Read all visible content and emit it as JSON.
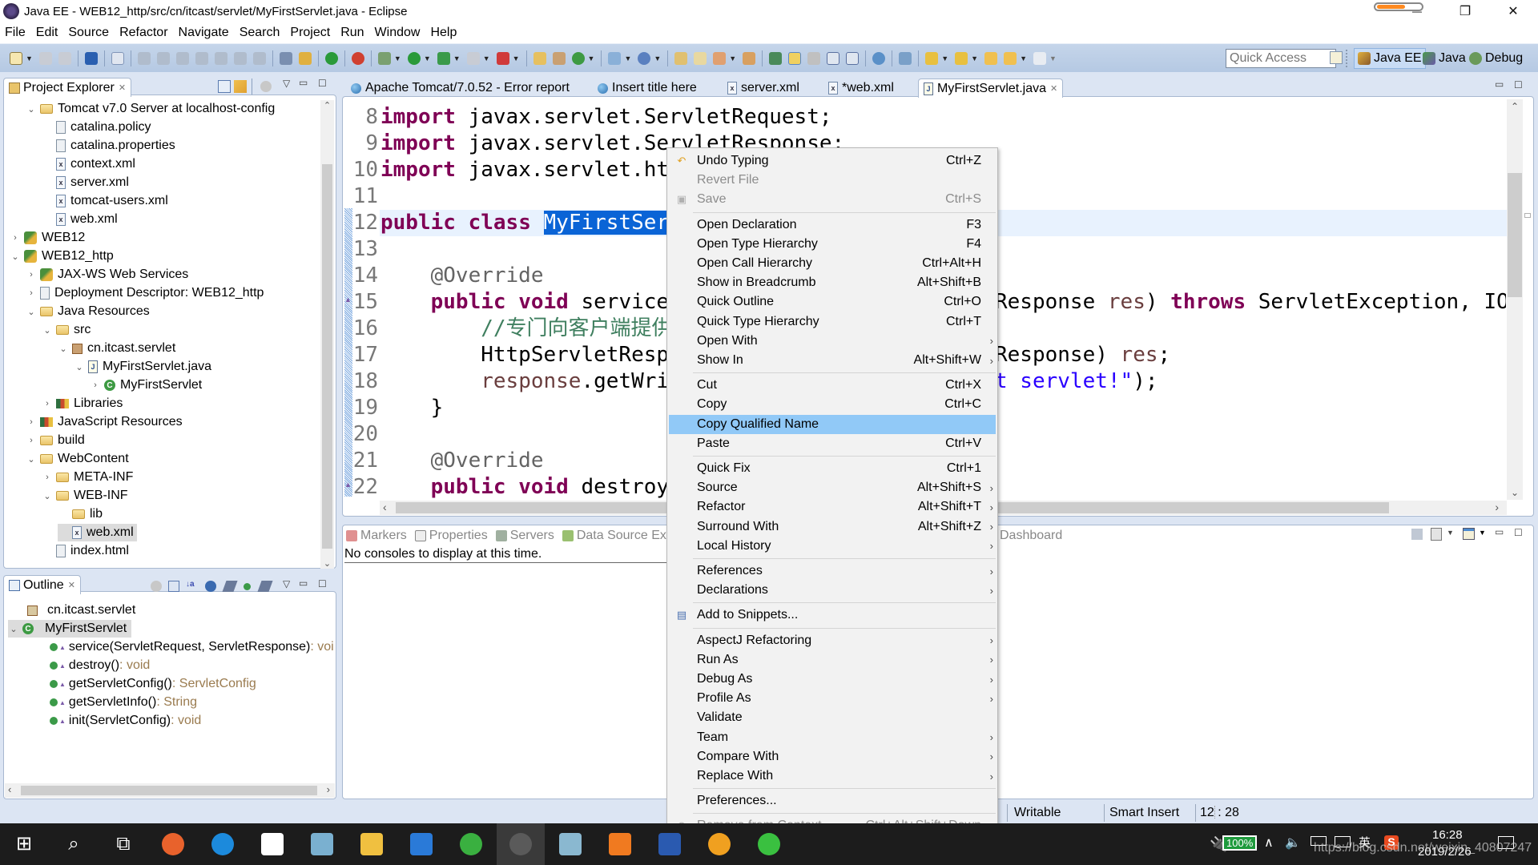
{
  "window": {
    "title": "Java EE - WEB12_http/src/cn/itcast/servlet/MyFirstServlet.java - Eclipse",
    "controls": {
      "minimize": "—",
      "restore": "❐",
      "close": "✕"
    },
    "background_progress_fraction": 0.65
  },
  "menubar": [
    "File",
    "Edit",
    "Source",
    "Refactor",
    "Navigate",
    "Search",
    "Project",
    "Run",
    "Window",
    "Help"
  ],
  "toolbar": {
    "quick_access_placeholder": "Quick Access",
    "perspectives": [
      {
        "label": "Java EE",
        "active": true
      },
      {
        "label": "Java",
        "active": false
      },
      {
        "label": "Debug",
        "active": false
      }
    ]
  },
  "project_explorer": {
    "title": "Project Explorer",
    "close": "✕",
    "items": [
      {
        "label": "Tomcat v7.0 Server at localhost-config",
        "twisty": "⌄",
        "icon": "folder-icon",
        "depth": 1
      },
      {
        "label": "catalina.policy",
        "twisty": "",
        "icon": "text-file-icon",
        "depth": 2
      },
      {
        "label": "catalina.properties",
        "twisty": "",
        "icon": "text-file-icon",
        "depth": 2
      },
      {
        "label": "context.xml",
        "twisty": "",
        "icon": "xml-file-icon",
        "depth": 2
      },
      {
        "label": "server.xml",
        "twisty": "",
        "icon": "xml-file-icon",
        "depth": 2
      },
      {
        "label": "tomcat-users.xml",
        "twisty": "",
        "icon": "xml-file-icon",
        "depth": 2
      },
      {
        "label": "web.xml",
        "twisty": "",
        "icon": "xml-file-icon",
        "depth": 2
      },
      {
        "label": "WEB12",
        "twisty": "›",
        "icon": "web-project-icon",
        "depth": 0
      },
      {
        "label": "WEB12_http",
        "twisty": "⌄",
        "icon": "web-project-icon",
        "depth": 0
      },
      {
        "label": "JAX-WS Web Services",
        "twisty": "›",
        "icon": "web-services-icon",
        "depth": 1
      },
      {
        "label": "Deployment Descriptor: WEB12_http",
        "twisty": "›",
        "icon": "deployment-descriptor-icon",
        "depth": 1
      },
      {
        "label": "Java Resources",
        "twisty": "⌄",
        "icon": "java-resources-icon",
        "depth": 1
      },
      {
        "label": "src",
        "twisty": "⌄",
        "icon": "source-folder-icon",
        "depth": 2
      },
      {
        "label": "cn.itcast.servlet",
        "twisty": "⌄",
        "icon": "package-icon",
        "depth": 3
      },
      {
        "label": "MyFirstServlet.java",
        "twisty": "⌄",
        "icon": "java-file-icon",
        "depth": 4
      },
      {
        "label": "MyFirstServlet",
        "twisty": "›",
        "icon": "class-icon",
        "depth": 5
      },
      {
        "label": "Libraries",
        "twisty": "›",
        "icon": "library-icon",
        "depth": 2
      },
      {
        "label": "JavaScript Resources",
        "twisty": "›",
        "icon": "library-icon",
        "depth": 1
      },
      {
        "label": "build",
        "twisty": "›",
        "icon": "folder-icon",
        "depth": 1
      },
      {
        "label": "WebContent",
        "twisty": "⌄",
        "icon": "folder-icon",
        "depth": 1
      },
      {
        "label": "META-INF",
        "twisty": "›",
        "icon": "folder-icon",
        "depth": 2
      },
      {
        "label": "WEB-INF",
        "twisty": "⌄",
        "icon": "folder-icon",
        "depth": 2
      },
      {
        "label": "lib",
        "twisty": "",
        "icon": "folder-icon",
        "depth": 3
      },
      {
        "label": "web.xml",
        "twisty": "",
        "icon": "xml-file-icon",
        "depth": 3,
        "selected": true
      },
      {
        "label": "index.html",
        "twisty": "",
        "icon": "html-file-icon",
        "depth": 2
      }
    ]
  },
  "outline": {
    "title": "Outline",
    "close": "✕",
    "package": "cn.itcast.servlet",
    "class_name": "MyFirstServlet",
    "members": [
      {
        "name": "service(ServletRequest, ServletResponse)",
        "type": " : voi"
      },
      {
        "name": "destroy()",
        "type": " : void"
      },
      {
        "name": "getServletConfig()",
        "type": " : ServletConfig"
      },
      {
        "name": "getServletInfo()",
        "type": " : String"
      },
      {
        "name": "init(ServletConfig)",
        "type": " : void"
      }
    ]
  },
  "editor": {
    "tabs": [
      {
        "label": "Apache Tomcat/7.0.52 - Error report",
        "icon": "globe-icon"
      },
      {
        "label": "Insert title here",
        "icon": "globe-icon"
      },
      {
        "label": "server.xml",
        "icon": "xml-file-icon"
      },
      {
        "label": "*web.xml",
        "icon": "xml-file-icon"
      },
      {
        "label": "MyFirstServlet.java",
        "icon": "java-file-icon",
        "active": true
      }
    ],
    "lines": [
      {
        "n": "8",
        "left": [
          {
            "t": "import",
            "c": "kw"
          },
          {
            "t": " javax.servlet.ServletRequest;",
            "c": ""
          }
        ],
        "right": []
      },
      {
        "n": "9",
        "left": [
          {
            "t": "import",
            "c": "kw"
          },
          {
            "t": " javax.servlet.ServletResponse;",
            "c": ""
          }
        ],
        "right": []
      },
      {
        "n": "10",
        "left": [
          {
            "t": "import",
            "c": "kw"
          },
          {
            "t": " javax.servlet.htt",
            "c": ""
          }
        ],
        "right": []
      },
      {
        "n": "11",
        "left": [],
        "right": []
      },
      {
        "n": "12",
        "left": [
          {
            "t": "public",
            "c": "kw"
          },
          {
            "t": " ",
            "c": ""
          },
          {
            "t": "class",
            "c": "kw"
          },
          {
            "t": " ",
            "c": ""
          },
          {
            "t": "MyFirstServ",
            "c": "hl"
          }
        ],
        "right": [],
        "current": true
      },
      {
        "n": "13",
        "left": [],
        "right": []
      },
      {
        "n": "14",
        "left": [
          {
            "t": "    @Override",
            "c": "ann"
          }
        ],
        "right": []
      },
      {
        "n": "15",
        "left": [
          {
            "t": "    ",
            "c": ""
          },
          {
            "t": "public",
            "c": "kw"
          },
          {
            "t": " ",
            "c": ""
          },
          {
            "t": "void",
            "c": "kw"
          },
          {
            "t": " service(",
            "c": ""
          }
        ],
        "right": [
          {
            "t": "Response ",
            "c": ""
          },
          {
            "t": "res",
            "c": "var"
          },
          {
            "t": ") ",
            "c": ""
          },
          {
            "t": "throws",
            "c": "kw"
          },
          {
            "t": " ServletException, IOEx",
            "c": ""
          }
        ],
        "override": true
      },
      {
        "n": "16",
        "left": [
          {
            "t": "        //专门向客户端提供",
            "c": "cmt"
          }
        ],
        "right": []
      },
      {
        "n": "17",
        "left": [
          {
            "t": "        HttpServletRespo",
            "c": ""
          }
        ],
        "right": [
          {
            "t": "Response) ",
            "c": ""
          },
          {
            "t": "res",
            "c": "var"
          },
          {
            "t": ";",
            "c": ""
          }
        ]
      },
      {
        "n": "18",
        "left": [
          {
            "t": "        ",
            "c": ""
          },
          {
            "t": "response",
            "c": "var"
          },
          {
            "t": ".getWrit",
            "c": ""
          }
        ],
        "right": [
          {
            "t": "t servlet!\"",
            "c": "str"
          },
          {
            "t": ");",
            "c": ""
          }
        ]
      },
      {
        "n": "19",
        "left": [
          {
            "t": "    }",
            "c": ""
          }
        ],
        "right": []
      },
      {
        "n": "20",
        "left": [],
        "right": []
      },
      {
        "n": "21",
        "left": [
          {
            "t": "    @Override",
            "c": "ann"
          }
        ],
        "right": []
      },
      {
        "n": "22",
        "left": [
          {
            "t": "    ",
            "c": ""
          },
          {
            "t": "public",
            "c": "kw"
          },
          {
            "t": " ",
            "c": ""
          },
          {
            "t": "void",
            "c": "kw"
          },
          {
            "t": " destroy(",
            "c": ""
          }
        ],
        "right": [],
        "override": true
      }
    ]
  },
  "context_menu": {
    "items": [
      {
        "label": "Undo Typing",
        "key": "Ctrl+Z",
        "icon": "undo-icon"
      },
      {
        "label": "Revert File",
        "disabled": true
      },
      {
        "label": "Save",
        "key": "Ctrl+S",
        "disabled": true,
        "icon": "save-icon"
      },
      {
        "sep": true
      },
      {
        "label": "Open Declaration",
        "key": "F3"
      },
      {
        "label": "Open Type Hierarchy",
        "key": "F4"
      },
      {
        "label": "Open Call Hierarchy",
        "key": "Ctrl+Alt+H"
      },
      {
        "label": "Show in Breadcrumb",
        "key": "Alt+Shift+B"
      },
      {
        "label": "Quick Outline",
        "key": "Ctrl+O"
      },
      {
        "label": "Quick Type Hierarchy",
        "key": "Ctrl+T"
      },
      {
        "label": "Open With",
        "submenu": true
      },
      {
        "label": "Show In",
        "key": "Alt+Shift+W",
        "submenu": true
      },
      {
        "sep": true
      },
      {
        "label": "Cut",
        "key": "Ctrl+X"
      },
      {
        "label": "Copy",
        "key": "Ctrl+C"
      },
      {
        "label": "Copy Qualified Name",
        "selected": true
      },
      {
        "label": "Paste",
        "key": "Ctrl+V"
      },
      {
        "sep": true
      },
      {
        "label": "Quick Fix",
        "key": "Ctrl+1"
      },
      {
        "label": "Source",
        "key": "Alt+Shift+S",
        "submenu": true
      },
      {
        "label": "Refactor",
        "key": "Alt+Shift+T",
        "submenu": true
      },
      {
        "label": "Surround With",
        "key": "Alt+Shift+Z",
        "submenu": true
      },
      {
        "label": "Local History",
        "submenu": true
      },
      {
        "sep": true
      },
      {
        "label": "References",
        "submenu": true
      },
      {
        "label": "Declarations",
        "submenu": true
      },
      {
        "sep": true
      },
      {
        "label": "Add to Snippets...",
        "icon": "snippets-icon"
      },
      {
        "sep": true
      },
      {
        "label": "AspectJ Refactoring",
        "submenu": true
      },
      {
        "label": "Run As",
        "submenu": true
      },
      {
        "label": "Debug As",
        "submenu": true
      },
      {
        "label": "Profile As",
        "submenu": true
      },
      {
        "label": "Validate"
      },
      {
        "label": "Team",
        "submenu": true
      },
      {
        "label": "Compare With",
        "submenu": true
      },
      {
        "label": "Replace With",
        "submenu": true
      },
      {
        "sep": true
      },
      {
        "label": "Preferences..."
      },
      {
        "sep": true
      },
      {
        "label": "Remove from Context",
        "key": "Ctrl+Alt+Shift+Down",
        "disabled": true,
        "icon": "remove-context-icon"
      }
    ]
  },
  "bottom_panel": {
    "tabs": [
      "Markers",
      "Properties",
      "Servers",
      "Data Source Ex",
      "Dashboard"
    ],
    "message": "No consoles to display at this time."
  },
  "status_bar": {
    "writable": "Writable",
    "insert_mode": "Smart Insert",
    "position": "12 : 28"
  },
  "taskbar": {
    "apps": [
      "start",
      "search",
      "task-view",
      "firefox",
      "internet-explorer",
      "calculator",
      "paint",
      "file-explorer",
      "translator",
      "360-browser",
      "eclipse-javaee",
      "notepad",
      "pdf-reader",
      "word",
      "idea-bulb",
      "wechat"
    ],
    "battery": "100%",
    "time": "16:28",
    "date": "2019/2/26",
    "watermark": "https://blog.csdn.net/weixin_40807247",
    "ime": "英"
  }
}
